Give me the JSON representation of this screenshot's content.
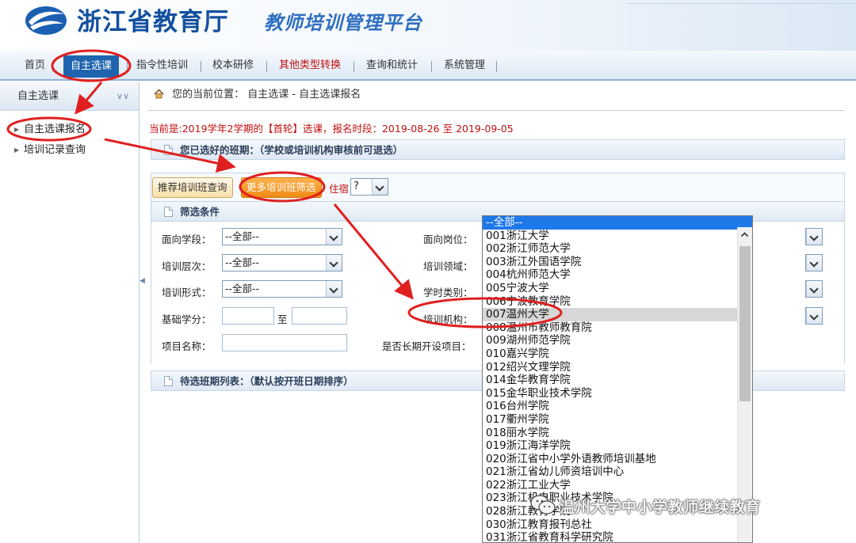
{
  "header": {
    "title": "浙江省教育厅",
    "subtitle": "教师培训管理平台"
  },
  "nav": {
    "items": [
      {
        "label": "首页"
      },
      {
        "label": "自主选课"
      },
      {
        "label": "指令性培训"
      },
      {
        "label": "校本研修"
      },
      {
        "label": "其他类型转换"
      },
      {
        "label": "查询和统计"
      },
      {
        "label": "系统管理"
      }
    ]
  },
  "sidebar": {
    "title": "自主选课",
    "items": [
      {
        "label": "自主选课报名"
      },
      {
        "label": "培训记录查询"
      }
    ]
  },
  "breadcrumb": {
    "prefix": "您的当前位置：",
    "path": "自主选课 - 自主选课报名"
  },
  "notice": "当前是:2019学年2学期的【首轮】选课，报名时段：2019-08-26 至 2019-09-05",
  "selected_section": {
    "title": "您已选好的班期：（学校或培训机构审核前可退选）"
  },
  "tabs": {
    "recommend": "推荐培训班查询",
    "more_filter": "更多培训班筛选",
    "lodging_label": "住宿",
    "lodging_value": "?"
  },
  "filter": {
    "title": "筛选条件",
    "stage_label": "面向学段：",
    "stage_value": "--全部--",
    "position_label": "面向岗位：",
    "level_label": "培训层次：",
    "level_value": "--全部--",
    "domain_label": "培训领域：",
    "form_label": "培训形式：",
    "form_value": "--全部--",
    "hours_label": "学时类别：",
    "credit_label": "基础学分：",
    "credit_to": "至",
    "institution_label": "培训机构：",
    "project_label": "项目名称：",
    "long_term_label": "是否长期开设项目："
  },
  "pending_section": {
    "title": "待选班期列表：（默认按开班日期排序）"
  },
  "institution_dropdown": {
    "options": [
      "--全部--",
      "001浙江大学",
      "002浙江师范大学",
      "003浙江外国语学院",
      "004杭州师范大学",
      "005宁波大学",
      "006宁波教育学院",
      "007温州大学",
      "008温州市教师教育院",
      "009湖州师范学院",
      "010嘉兴学院",
      "012绍兴文理学院",
      "014金华教育学院",
      "015金华职业技术学院",
      "016台州学院",
      "017衢州学院",
      "018丽水学院",
      "019浙江海洋学院",
      "020浙江省中小学外语教师培训基地",
      "021浙江省幼儿师资培训中心",
      "022浙江工业大学",
      "023浙江机电职业技术学院",
      "028浙江教育学院",
      "030浙江教育报刊总社",
      "031浙江省教育科学研究院"
    ],
    "selected_index": 0,
    "hover_index": 7
  },
  "watermark": "温州大学中小学教师继续教育"
}
